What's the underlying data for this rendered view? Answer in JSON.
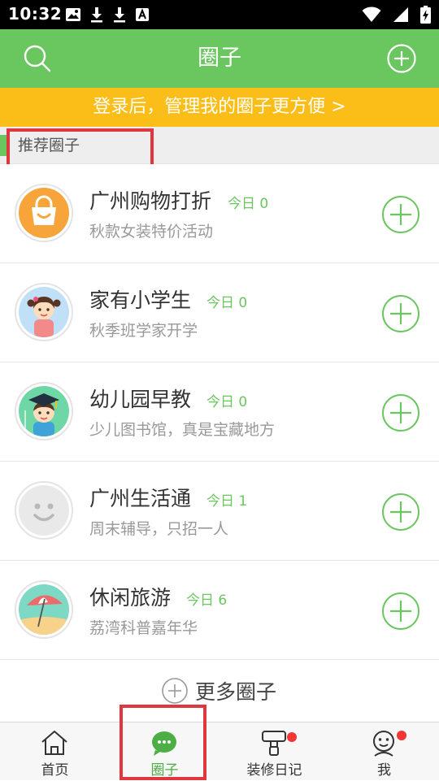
{
  "status_bar": {
    "time": "10:32",
    "left_icons": [
      "image-icon",
      "download-icon",
      "download-icon",
      "text-a-icon"
    ],
    "right_icons": [
      "wifi-icon",
      "signal-icon",
      "battery-charging-icon"
    ]
  },
  "header": {
    "title": "圈子",
    "left_icon": "search-icon",
    "right_icon": "add-circle-icon"
  },
  "login_banner": {
    "text": "登录后，管理我的圈子更方便 >"
  },
  "section": {
    "label": "推荐圈子"
  },
  "circles": [
    {
      "name": "广州购物打折",
      "today": "今日 0",
      "desc": "秋款女装特价活动",
      "avatar": "shopping-bag-icon"
    },
    {
      "name": "家有小学生",
      "today": "今日 0",
      "desc": "秋季班学家开学",
      "avatar": "schoolgirl-icon"
    },
    {
      "name": "幼儿园早教",
      "today": "今日 0",
      "desc": "少儿图书馆，真是宝藏地方",
      "avatar": "graduate-boy-icon"
    },
    {
      "name": "广州生活通",
      "today": "今日 1",
      "desc": "周末辅导，只招一人",
      "avatar": "smiley-placeholder-icon"
    },
    {
      "name": "休闲旅游",
      "today": "今日 6",
      "desc": "荔湾科普嘉年华",
      "avatar": "beach-umbrella-icon"
    }
  ],
  "more": {
    "label": "更多圈子",
    "icon": "plus-circle-icon"
  },
  "tab_bar": {
    "tabs": [
      {
        "label": "首页",
        "icon": "home-icon",
        "active": false,
        "badge": false
      },
      {
        "label": "圈子",
        "icon": "chat-bubble-icon",
        "active": true,
        "badge": false
      },
      {
        "label": "装修日记",
        "icon": "paint-roller-icon",
        "active": false,
        "badge": true
      },
      {
        "label": "我",
        "icon": "user-face-icon",
        "active": false,
        "badge": true
      }
    ]
  },
  "colors": {
    "brand_green": "#6ac65e",
    "banner_yellow": "#fbbd18",
    "highlight_red": "#e0373f",
    "badge_red": "#f23535"
  }
}
